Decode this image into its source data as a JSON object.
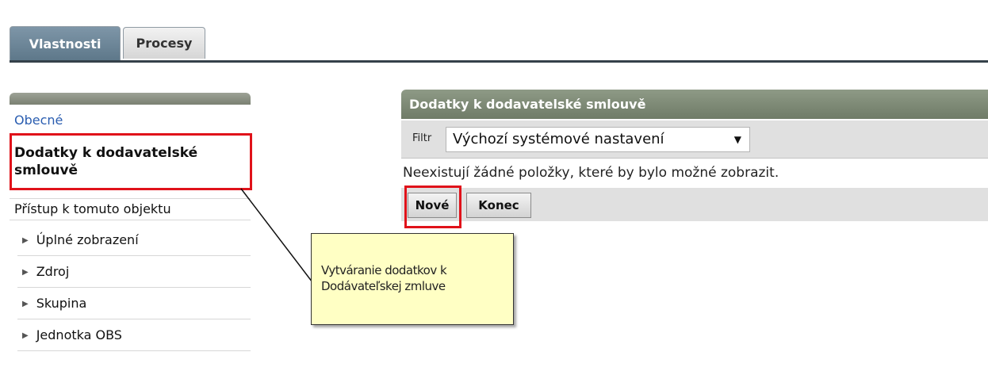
{
  "tabs": [
    {
      "label": "Vlastnosti",
      "active": true
    },
    {
      "label": "Procesy",
      "active": false
    }
  ],
  "sidebar": {
    "items": [
      {
        "label": "Obecné"
      },
      {
        "label": "Dodatky k dodavatelské smlouvě",
        "selected": true
      },
      {
        "label": "Přístup k tomuto objektu"
      }
    ],
    "sub_items": [
      {
        "label": "Úplné zobrazení"
      },
      {
        "label": "Zdroj"
      },
      {
        "label": "Skupina"
      },
      {
        "label": "Jednotka OBS"
      }
    ]
  },
  "panel": {
    "title": "Dodatky k dodavatelské smlouvě",
    "filter_label": "Filtr",
    "filter_value": "Výchozí systémové nastavení",
    "empty_message": "Neexistují žádné položky, které by bylo možné zobrazit.",
    "buttons": {
      "new_label": "Nové",
      "end_label": "Konec"
    }
  },
  "callout": {
    "line1": "Vytváranie dodatkov k",
    "line2": "Dodávateľskej zmluve"
  },
  "colors": {
    "tab_active": "#6a8495",
    "panel_header": "#7f8b77",
    "highlight": "#e0121a",
    "callout_bg": "#ffffc4"
  }
}
